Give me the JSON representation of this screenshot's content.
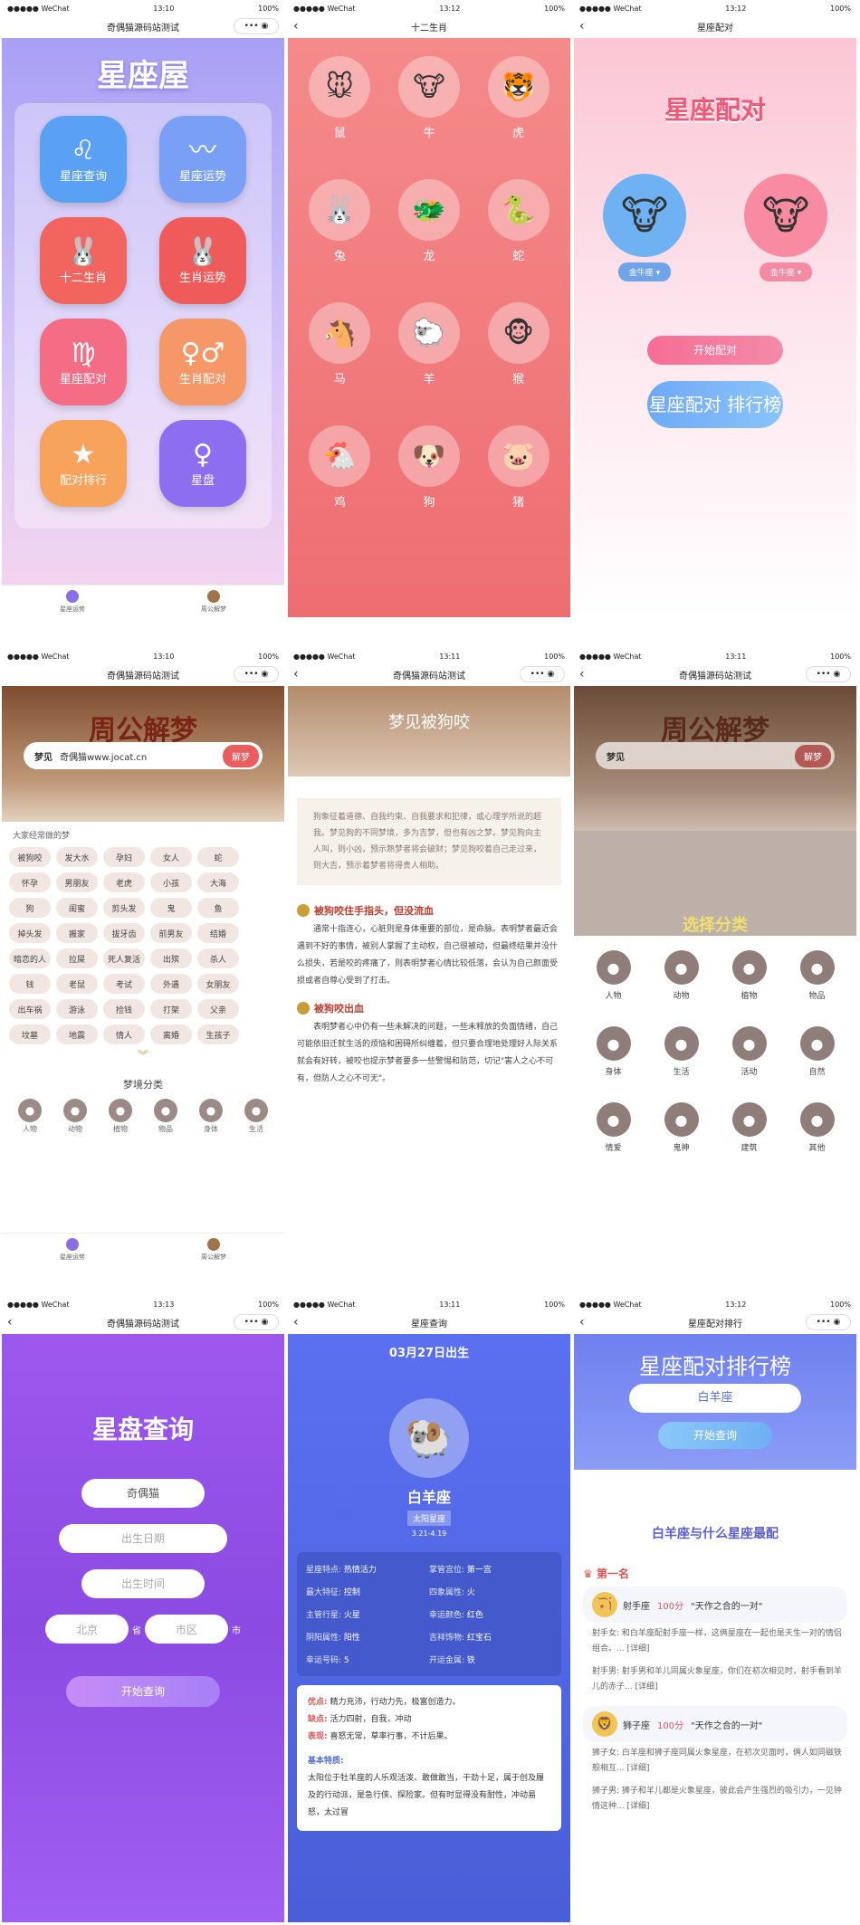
{
  "status": {
    "carrier": "●●●●● WeChat",
    "battery": "100%"
  },
  "s1": {
    "time": "13:10",
    "title": "奇偶猫源码站测试",
    "logo": "星座屋",
    "apps": [
      {
        "label": "星座查询",
        "glyph": "♌",
        "color": "#5aa0f5"
      },
      {
        "label": "星座运势",
        "glyph": "〰",
        "color": "#7aa0f5"
      },
      {
        "label": "十二生肖",
        "glyph": "🐰",
        "color": "#f2655f"
      },
      {
        "label": "生肖运势",
        "glyph": "🐰",
        "color": "#ef5a5a"
      },
      {
        "label": "星座配对",
        "glyph": "♍",
        "color": "#f46d85"
      },
      {
        "label": "生肖配对",
        "glyph": "♀♂",
        "color": "#f69767"
      },
      {
        "label": "配对排行",
        "glyph": "★",
        "color": "#f7a35c"
      },
      {
        "label": "星盘",
        "glyph": "♀",
        "color": "#8e6ef0"
      }
    ],
    "tab1": "星座运势",
    "tab2": "周公解梦"
  },
  "s2": {
    "time": "13:12",
    "title": "十二生肖",
    "animals": [
      {
        "name": "鼠",
        "emoji": "🐭"
      },
      {
        "name": "牛",
        "emoji": "🐮"
      },
      {
        "name": "虎",
        "emoji": "🐯"
      },
      {
        "name": "兔",
        "emoji": "🐰"
      },
      {
        "name": "龙",
        "emoji": "🐲"
      },
      {
        "name": "蛇",
        "emoji": "🐍"
      },
      {
        "name": "马",
        "emoji": "🐴"
      },
      {
        "name": "羊",
        "emoji": "🐑"
      },
      {
        "name": "猴",
        "emoji": "🐵"
      },
      {
        "name": "鸡",
        "emoji": "🐔"
      },
      {
        "name": "狗",
        "emoji": "🐶"
      },
      {
        "name": "猪",
        "emoji": "🐷"
      }
    ]
  },
  "s3": {
    "time": "13:12",
    "title": "星座配对",
    "heading": "星座配对",
    "left": "金牛座",
    "right": "金牛座",
    "start": "开始配对",
    "rank": "星座配对 排行榜"
  },
  "s4": {
    "time": "13:10",
    "title": "奇偶猫源码站测试",
    "heading": "周公解梦",
    "search_label": "梦见",
    "search_value": "奇偶猫www.jocat.cn",
    "search_btn": "解梦",
    "common": "大家经常做的梦",
    "tags": [
      "被狗咬",
      "发大水",
      "孕妇",
      "女人",
      "蛇",
      "怀孕",
      "男朋友",
      "老虎",
      "小孩",
      "大海",
      "狗",
      "闺蜜",
      "剪头发",
      "鬼",
      "鱼",
      "掉头发",
      "搬家",
      "拔牙齿",
      "前男友",
      "结婚",
      "暗恋的人",
      "拉屎",
      "死人复活",
      "出殡",
      "杀人",
      "钱",
      "老鼠",
      "考试",
      "外遇",
      "女朋友",
      "出车祸",
      "游泳",
      "捡钱",
      "打架",
      "父亲",
      "坟墓",
      "地震",
      "情人",
      "离婚",
      "生孩子"
    ],
    "cat_title": "梦境分类",
    "cats": [
      "人物",
      "动物",
      "植物",
      "物品",
      "身体",
      "生活"
    ],
    "tab1": "星座运势",
    "tab2": "周公解梦"
  },
  "s5": {
    "time": "13:11",
    "title": "奇偶猫源码站测试",
    "heading": "梦见被狗咬",
    "quote": "狗象征着道德、自我约束、自我要求和犯律，或心理学所说的超我。梦见狗的不同梦境，多为吉梦，但也有凶之梦。梦见狗向主人叫，则小凶，预示熟梦者将会破财；梦见狗咬着自己走过来，则大吉，预示着梦者将得贵人相助。",
    "sec1_title": "被狗咬住手指头，但没流血",
    "sec1_body": "通常十指连心，心脏则是身体重要的部位，是命脉。表明梦者最近会遇到不好的事情，被别人掌握了主动权，自己很被动，但最终结果并没什么损失，若是咬的疼痛了，则表明梦者心情比较低落，会认为自己颜面受损或者自尊心受到了打击。",
    "sec2_title": "被狗咬出血",
    "sec2_body": "表明梦者心中仍有一些未解决的问题，一些未释放的负面情绪，自己可能依旧迁就生活的烦恼和困碍所纠缠着，但只要合理地处理好人际关系就会有好转，被咬也提示梦者要多一些警惕和防范，切记\"害人之心不可有，但防人之心不可无\"。"
  },
  "s6": {
    "time": "13:11",
    "title": "奇偶猫源码站测试",
    "heading": "周公解梦",
    "search_label": "梦见",
    "search_btn": "解梦",
    "select_title": "选择分类",
    "cats": [
      "人物",
      "动物",
      "植物",
      "物品",
      "身体",
      "生活",
      "活动",
      "自然",
      "情爱",
      "鬼神",
      "建筑",
      "其他"
    ]
  },
  "s7": {
    "time": "13:13",
    "title": "奇偶猫源码站测试",
    "heading": "星盘查询",
    "name": "奇偶猫",
    "birth_date": "出生日期",
    "birth_time": "出生时间",
    "province": "北京",
    "prov_suffix": "省",
    "city": "市区",
    "city_suffix": "市",
    "btn": "开始查询"
  },
  "s8": {
    "time": "13:11",
    "title": "星座查询",
    "date": "03月27日出生",
    "name": "白羊座",
    "badge": "太阳星座",
    "range": "3.21-4.19",
    "info": [
      [
        "星座特点:",
        "热情活力"
      ],
      [
        "掌管宫位:",
        "第一宫"
      ],
      [
        "最大特征:",
        "控制"
      ],
      [
        "四象属性:",
        "火"
      ],
      [
        "主管行星:",
        "火星"
      ],
      [
        "幸运颜色:",
        "红色"
      ],
      [
        "阴阳属性:",
        "阳性"
      ],
      [
        "吉祥饰物:",
        "红宝石"
      ],
      [
        "幸运号码:",
        "5"
      ],
      [
        "开运金属:",
        "铁"
      ]
    ],
    "good_k": "优点:",
    "good_v": "精力充沛，行动力先，极富创造力。",
    "bad_k": "缺点:",
    "bad_v": "活力四射，自我，冲动",
    "show_k": "表现:",
    "show_v": "喜怒无常，草率行事，不计后果。",
    "basic_k": "基本特质:",
    "basic_v": "太阳位于牡羊座的人乐观活泼、敢做敢当，干劲十足，属于创及履及的行动派，是急行侠、探险家。但有时显得没有耐性，冲动易怒，太过冒"
  },
  "s9": {
    "time": "13:12",
    "title": "星座配对排行",
    "heading": "星座配对排行榜",
    "input": "白羊座",
    "btn": "开始查询",
    "subheading": "白羊座与什么星座最配",
    "rank1": "第一名",
    "m1_name": "射手座",
    "m1_score": "100分",
    "m1_tag": "\"天作之合的一对\"",
    "m1_f": "射手女: 和白羊座配射手座一样，这俩星座在一起也是天生一对的情侣组合。... [详细]",
    "m1_m": "射手男: 射手男和羊儿同属火象星座，你们在初次相见时，射手看到羊儿的赤子... [详细]",
    "m2_name": "狮子座",
    "m2_score": "100分",
    "m2_tag": "\"天作之合的一对\"",
    "m2_f": "狮子女: 白羊座和狮子座同属火象星座，在初次见面时，俩人如同磁铁般相互... [详细]",
    "m2_m": "狮子男: 狮子和羊儿都是火象星座，彼此会产生强烈的吸引力，一见钟情这种... [详细]"
  }
}
